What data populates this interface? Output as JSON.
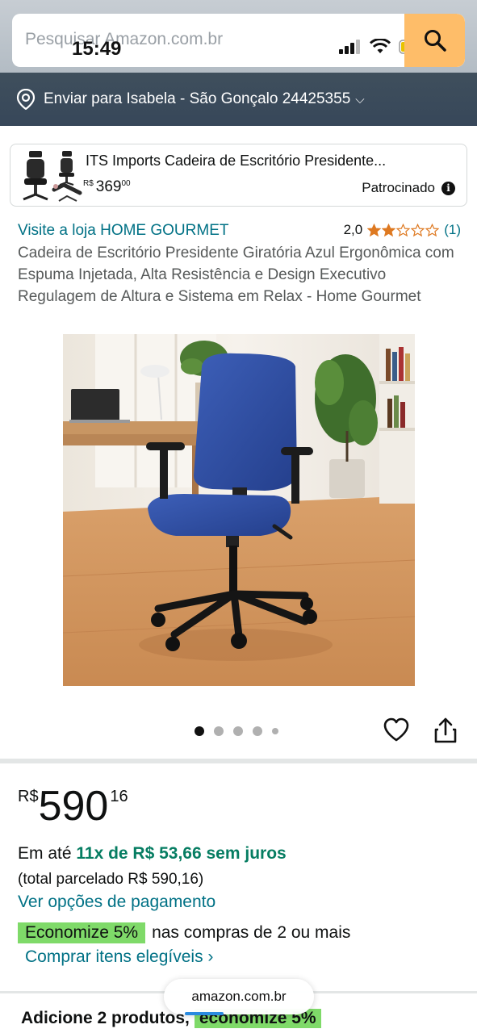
{
  "status_bar": {
    "time": "15:49"
  },
  "search": {
    "placeholder": "Pesquisar Amazon.com.br"
  },
  "delivery": {
    "text": "Enviar para Isabela - São Gonçalo 24425355"
  },
  "sponsored": {
    "title": "ITS Imports Cadeira de Escritório Presidente...",
    "price_currency": "R$",
    "price_whole": "369",
    "price_cents": "00",
    "label": "Patrocinado"
  },
  "store": {
    "link": "Visite a loja HOME GOURMET"
  },
  "rating": {
    "value": "2,0",
    "stars": 2,
    "count": "(1)"
  },
  "product": {
    "title": "Cadeira de Escritório Presidente Giratória Azul Ergonômica com Espuma Injetada, Alta Resistência e Design Executivo Regulagem de Altura e Sistema em Relax - Home Gourmet"
  },
  "carousel": {
    "total": 5,
    "active": 0
  },
  "price": {
    "currency": "R$",
    "whole": "590",
    "cents": "16"
  },
  "installment": {
    "prefix": "Em até",
    "highlight": "11x de R$ 53,66 sem juros",
    "total": "(total parcelado R$ 590,16)",
    "payment_link": "Ver opções de pagamento"
  },
  "savings": {
    "badge": "Economize 5%",
    "text": "nas compras de 2 ou mais",
    "link": "Comprar itens elegíveis ›"
  },
  "add_products": {
    "text": "Adicione 2 produtos,",
    "badge": "economize 5%"
  },
  "browser": {
    "url": "amazon.com.br"
  },
  "colors": {
    "link": "#007185",
    "accent": "#febd69",
    "header": "#37475a",
    "deal_green": "#7fda69",
    "star": "#de7921"
  }
}
